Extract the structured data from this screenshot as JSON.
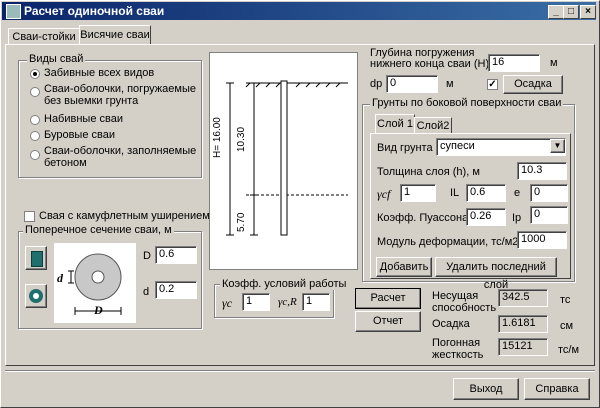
{
  "window": {
    "title": "Расчет одиночной сваи",
    "controls": [
      "_",
      "□",
      "×"
    ]
  },
  "tabs": [
    "Сваи-стойки",
    "Висячие сваи"
  ],
  "pile_types": {
    "title": "Виды свай",
    "options": [
      "Забивные всех видов",
      "Сваи-оболочки, погружаемые\nбез выемки грунта",
      "Набивные сваи",
      "Буровые сваи",
      "Сваи-оболочки, заполняемые\nбетоном"
    ],
    "selected": 0
  },
  "camouflet": {
    "label": "Свая с камуфлетным уширением",
    "checked": false
  },
  "cross_section": {
    "title": "Поперечное сечение сваи, м",
    "D_label": "D",
    "D_value": "0.6",
    "d_label": "d",
    "d_value": "0.2",
    "fig_D": "D",
    "fig_d": "d"
  },
  "drawing": {
    "H_label": "H= 16.00",
    "depth1": "10.30",
    "depth2": "5.70"
  },
  "work_coef": {
    "title": "Коэфф. условий работы",
    "gc_label": "γc",
    "gc_value": "1",
    "gcr_label": "γc,R",
    "gcr_value": "1"
  },
  "depth": {
    "label": "Глубина погружения\nнижнего конца сваи (H)",
    "value": "16",
    "unit": "м"
  },
  "dp": {
    "label": "dp",
    "value": "0",
    "unit": "м",
    "settle_checked": true,
    "settle_label": "Осадка"
  },
  "soils": {
    "title": "Грунты по боковой поверхности сваи",
    "layer_tabs": [
      "Слой 1",
      "Слой2"
    ],
    "soil_type_label": "Вид грунта",
    "soil_type_value": "супеси",
    "thickness_label": "Толщина слоя (h), м",
    "thickness_value": "10.3",
    "gcf_label": "γcf",
    "gcf_value": "1",
    "IL_label": "IL",
    "IL_value": "0.6",
    "e_label": "e",
    "e_value": "0",
    "poisson_label": "Коэфф. Пуассона",
    "poisson_value": "0.26",
    "Ip_label": "Ip",
    "Ip_value": "0",
    "modulus_label": "Модуль деформации, тс/м2",
    "modulus_value": "1000",
    "add_button": "Добавить",
    "delete_button": "Удалить последний слой"
  },
  "actions": {
    "calc": "Расчет",
    "report": "Отчет",
    "exit": "Выход",
    "help": "Справка"
  },
  "results": {
    "capacity_label": "Несущая\nспособность",
    "capacity_value": "342.5",
    "capacity_unit": "тс",
    "settle_label": "Осадка",
    "settle_value": "1.6181",
    "settle_unit": "см",
    "stiffness_label": "Погонная\nжесткость",
    "stiffness_value": "15121",
    "stiffness_unit": "тс/м"
  },
  "icons": {
    "square_section": "square-section-icon",
    "ring_section": "ring-section-icon",
    "dropdown": "chevron-down-icon"
  }
}
